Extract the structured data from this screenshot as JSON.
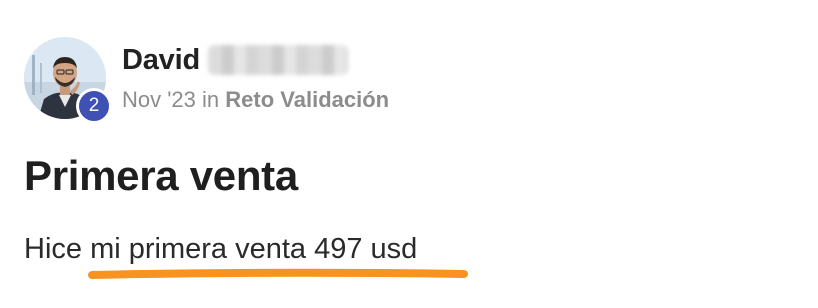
{
  "post": {
    "author": {
      "name": "David",
      "level": "2"
    },
    "meta": {
      "date": "Nov '23",
      "in_word": "in",
      "space": "Reto Validación"
    },
    "title": "Primera venta",
    "body": "Hice mi primera venta 497 usd"
  },
  "colors": {
    "badge": "#3f51b5",
    "highlight": "#f7931e"
  }
}
